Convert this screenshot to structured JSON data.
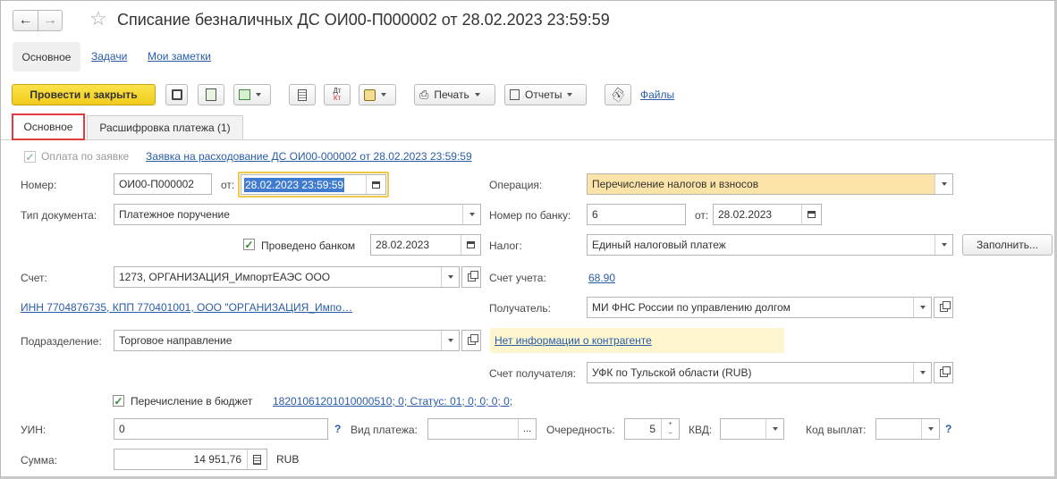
{
  "window": {
    "title": "Списание безналичных ДС ОИ00-П000002 от 28.02.2023 23:59:59"
  },
  "nav_tabs": [
    "Основное",
    "Задачи",
    "Мои заметки"
  ],
  "toolbar": {
    "post_close": "Провести и закрыть",
    "print": "Печать",
    "reports": "Отчеты",
    "files": "Файлы",
    "dt_kt_top": "Дт",
    "dt_kt_bottom": "Кт"
  },
  "form_tabs": [
    "Основное",
    "Расшифровка платежа (1)"
  ],
  "colors": {
    "primary_button": "#f5d323",
    "highlight_field": "#fce3a8",
    "selection": "#3f7ccf",
    "tab_highlight": "#e23b3b",
    "link": "#2a5ca8",
    "info_bg": "#fdf6cf"
  },
  "form": {
    "by_request_label": "Оплата по заявке",
    "by_request_link": "Заявка на расходование ДС ОИ00-000002 от 28.02.2023 23:59:59",
    "number_label": "Номер:",
    "number_value": "ОИ00-П000002",
    "from_label": "от:",
    "date_value": "28.02.2023 23:59:59",
    "doc_type_label": "Тип документа:",
    "doc_type_value": "Платежное поручение",
    "bank_posted_label": "Проведено банком",
    "bank_posted_date": "28.02.2023",
    "account_label": "Счет:",
    "account_value": "1273, ОРГАНИЗАЦИЯ_ИмпортЕАЭС ООО",
    "inn_link": "ИНН 7704876735, КПП 770401001, ООО \"ОРГАНИЗАЦИЯ_Импо…",
    "division_label": "Подразделение:",
    "division_value": "Торговое направление",
    "operation_label": "Операция:",
    "operation_value": "Перечисление налогов и взносов",
    "bank_number_label": "Номер по банку:",
    "bank_number_value": "6",
    "bank_from_label": "от:",
    "bank_date_value": "28.02.2023",
    "tax_label": "Налог:",
    "tax_value": "Единый налоговый платеж",
    "fill_button": "Заполнить...",
    "acc_label": "Счет учета:",
    "acc_value": "68.90",
    "recipient_label": "Получатель:",
    "recipient_value": "МИ ФНС России по управлению долгом",
    "no_info_link": "Нет информации о контрагенте",
    "recipient_acc_label": "Счет получателя:",
    "recipient_acc_value": "УФК по Тульской области (RUB)",
    "budget_label": "Перечисление в бюджет",
    "budget_link": "18201061201010000510; 0; Статус: 01; 0; 0; 0; 0;",
    "uin_label": "УИН:",
    "uin_value": "0",
    "help_mark": "?",
    "payment_type_label": "Вид платежа:",
    "payment_type_ellipsis": "...",
    "priority_label": "Очередность:",
    "priority_value": "5",
    "kvd_label": "КВД:",
    "payout_code_label": "Код выплат:",
    "sum_label": "Сумма:",
    "sum_value": "14 951,76",
    "currency": "RUB"
  }
}
